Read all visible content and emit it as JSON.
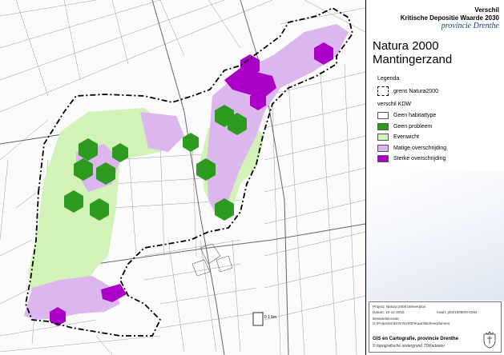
{
  "header": {
    "line1": "Verschil",
    "line2": "Kritische Depositie Waarde 2030",
    "line3": "provincie Drenthe"
  },
  "title": {
    "line1": "Natura 2000",
    "line2": "Mantingerzand"
  },
  "legend": {
    "title": "Legenda",
    "boundary_label": "grens Natura2000",
    "kdw_title": "verschil KDW",
    "items": [
      {
        "label": "Geen habitattype",
        "color": "#ffffff"
      },
      {
        "label": "Geen probleem",
        "color": "#2e9a1f"
      },
      {
        "label": "Evenwicht",
        "color": "#d2f2b8"
      },
      {
        "label": "Matige overschrijding",
        "color": "#dcb6ee"
      },
      {
        "label": "Sterke overschrijding",
        "color": "#aa00c8"
      }
    ]
  },
  "project_box": {
    "project": "Project: Natura 2000 beheerplan",
    "datum": "Datum: 10-12-2015",
    "kaart": "Kaart: pl2015080/9-0263",
    "bestandslocatie_label": "Bestandslocatie:",
    "bestandslocatie": "G:\\Projecten\\DrGr\\N2000\\Kaart\\Beheerplannen",
    "organization": "GIS en Cartografie, provincie Drenthe",
    "source": "© topografische ondergrond TDKadaster"
  },
  "scale": {
    "label": "0   1 km"
  }
}
